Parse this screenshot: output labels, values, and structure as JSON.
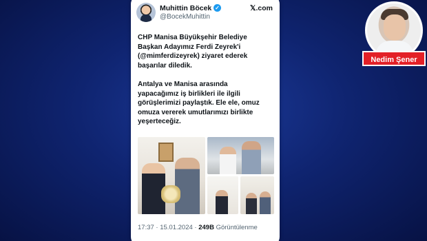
{
  "tweet": {
    "author": {
      "display_name": "Muhittin Böcek",
      "handle": "@BocekMuhittin",
      "verified_icon": "verified-check-icon"
    },
    "platform": "𝕏.com",
    "paragraphs": [
      "CHP Manisa Büyükşehir Belediye\nBaşkan Adayımız Ferdi Zeyrek'i\n(@mimferdizeyrek) ziyaret ederek\nbaşarılar diledik.",
      "Antalya ve Manisa arasında\nyapacağımız iş birlikleri ile ilgili\ngörüşlerimizi paylaştık. Ele ele, omuz\nomuza vererek umutlarımızı birlikte\nyeşerteceğiz."
    ],
    "meta": {
      "time_date": "17:37 · 15.01.2024 · ",
      "views_count": "249B",
      "views_label": " Görüntülenme"
    }
  },
  "author_badge": {
    "name": "Nedim Şener",
    "accent_color": "#e32027"
  },
  "colors": {
    "background": "#0f2470",
    "verified": "#1d9bf0",
    "text_primary": "#0f1419",
    "text_secondary": "#536471"
  }
}
